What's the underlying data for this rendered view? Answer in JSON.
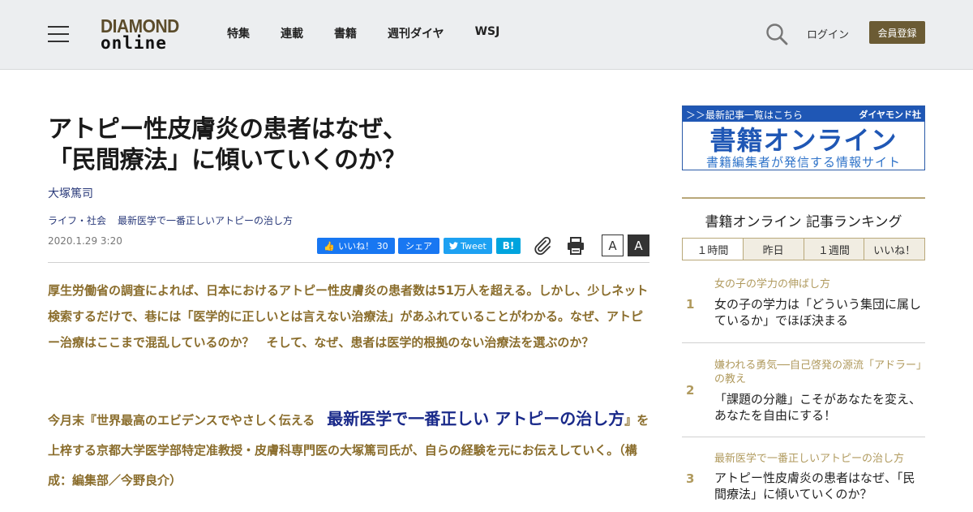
{
  "header": {
    "logo_line1": "DIAMOND",
    "logo_line2": "online",
    "nav": [
      "特集",
      "連載",
      "書籍",
      "週刊ダイヤ",
      "WSJ"
    ],
    "login": "ログイン",
    "register": "会員登録"
  },
  "article": {
    "title_line1": "アトピー性皮膚炎の患者はなぜ、",
    "title_line2": "「民間療法」に傾いていくのか？",
    "author": "大塚篤司",
    "tags": [
      "ライフ・社会",
      "最新医学で一番正しいアトピーの治し方"
    ],
    "date": "2020.1.29 3:20",
    "share": {
      "like": "いいね！ 30",
      "fb_share": "シェア",
      "tweet": "Tweet",
      "hatena": "B!"
    },
    "font_small": "A",
    "font_large": "A",
    "lead": "厚生労働省の調査によれば、日本におけるアトピー性皮膚炎の患者数は51万人を超える。しかし、少しネット検索するだけで、巷には「医学的に正しいとは言えない治療法」があふれていることがわかる。なぜ、アトピー治療はここまで混乱しているのか？　そして、なぜ、患者は医学的根拠のない治療法を選ぶのか？",
    "intro_a": "今月末『世界最高のエビデンスでやさしく伝える　",
    "intro_book": "最新医学で一番正しい アトピーの治し方",
    "intro_b": "』を上梓する京都大学医学部特定准教授・皮膚科専門医の大塚篤司氏が、自らの経験を元にお伝えしていく。（構成：編集部／今野良介）"
  },
  "sidebar": {
    "banner_top_left": "＞＞最新記事一覧はこちら",
    "banner_top_right": "ダイヤモンド社",
    "banner_big": "書籍オンライン",
    "banner_sub": "書籍編集者が発信する情報サイト",
    "ranking_title": "書籍オンライン 記事ランキング",
    "tabs": [
      "１時間",
      "昨日",
      "１週間",
      "いいね！"
    ],
    "items": [
      {
        "num": "1",
        "category": "女の子の学力の伸ばし方",
        "headline": "女の子の学力は「どういう集団に属しているか」でほぼ決まる"
      },
      {
        "num": "2",
        "category": "嫌われる勇気──自己啓発の源流「アドラー」の教え",
        "headline": "「課題の分離」こそがあなたを変え、あなたを自由にする！"
      },
      {
        "num": "3",
        "category": "最新医学で一番正しいアトピーの治し方",
        "headline": "アトピー性皮膚炎の患者はなぜ、「民間療法」に傾いていくのか？"
      }
    ]
  }
}
